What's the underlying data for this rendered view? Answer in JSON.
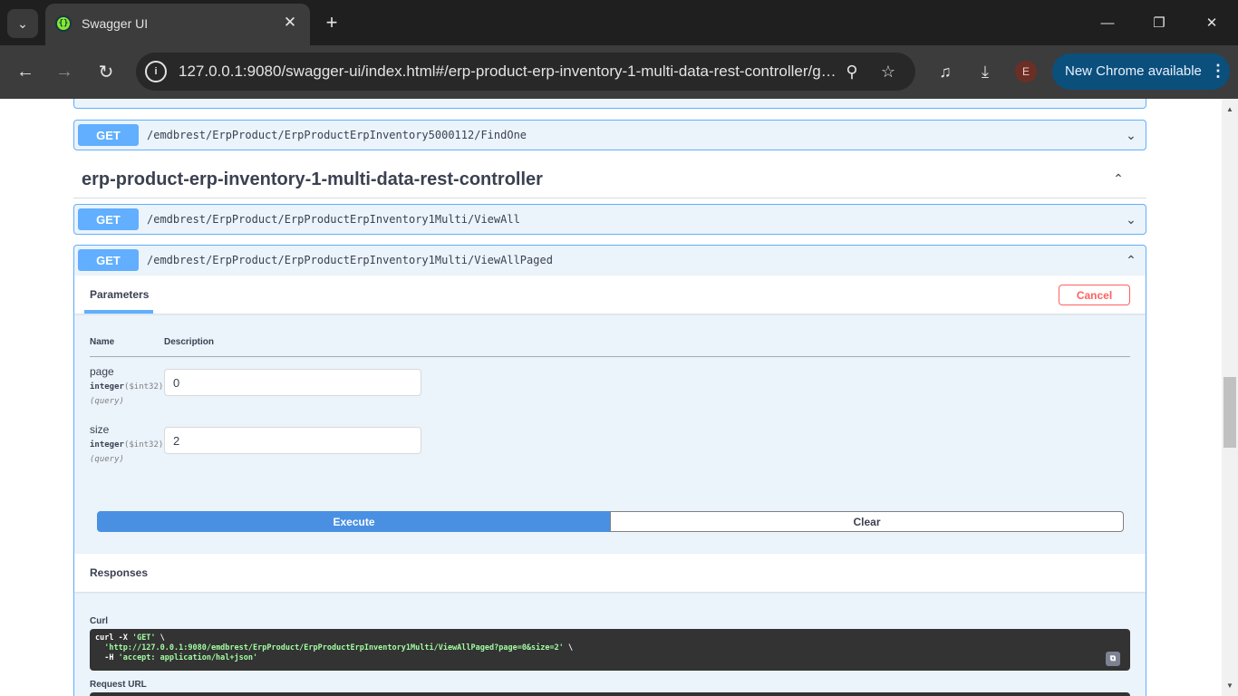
{
  "browser": {
    "tab_title": "Swagger UI",
    "url": "127.0.0.1:9080/swagger-ui/index.html#/erp-product-erp-inventory-1-multi-data-rest-controller/getViewAllPaged",
    "avatar_letter": "E",
    "update_label": "New Chrome available",
    "icons": {
      "tab_menu": "chevron-down-icon",
      "favicon": "swagger-icon",
      "close": "close-icon",
      "new_tab": "plus-icon",
      "back": "back-arrow-icon",
      "forward": "forward-arrow-icon",
      "reload": "reload-icon",
      "site_info": "site-info-icon",
      "zoom": "search-icon",
      "bookmark": "star-icon",
      "media": "media-icon",
      "download": "download-icon",
      "menu": "kebab-icon"
    },
    "colors": {
      "chrome_bg": "#1f1f1f",
      "toolbar_bg": "#3c3c3c",
      "update_chip": "#0b4f7c"
    }
  },
  "page": {
    "prev_op": {
      "method": "GET",
      "path": "/emdbrest/ErpProduct/ErpProductErpInventory5000112/FindOne"
    },
    "tag": {
      "title": "erp-product-erp-inventory-1-multi-data-rest-controller"
    },
    "ops": [
      {
        "method": "GET",
        "path": "/emdbrest/ErpProduct/ErpProductErpInventory1Multi/ViewAll"
      },
      {
        "method": "GET",
        "path": "/emdbrest/ErpProduct/ErpProductErpInventory1Multi/ViewAllPaged"
      }
    ],
    "expanded": {
      "params_tab": "Parameters",
      "cancel_label": "Cancel",
      "col_name": "Name",
      "col_description": "Description",
      "params": [
        {
          "name": "page",
          "type": "integer",
          "format": "($int32)",
          "in": "(query)",
          "value": "0"
        },
        {
          "name": "size",
          "type": "integer",
          "format": "($int32)",
          "in": "(query)",
          "value": "2"
        }
      ],
      "execute_label": "Execute",
      "clear_label": "Clear",
      "responses_label": "Responses",
      "curl_label": "Curl",
      "curl": {
        "l1_cmd": "curl -X ",
        "l1_method": "'GET'",
        "l1_end": " \\",
        "l2_url": "'http://127.0.0.1:9080/emdbrest/ErpProduct/ErpProductErpInventory1Multi/ViewAllPaged?page=0&size=2'",
        "l2_end": " \\",
        "l3_flag": "  -H ",
        "l3_header": "'accept: application/hal+json'"
      },
      "request_url_label": "Request URL"
    },
    "colors": {
      "get_blue": "#61affe",
      "get_bg": "#ebf3fb",
      "execute": "#4990e2",
      "cancel": "#ff6060",
      "code_bg": "#333333"
    }
  }
}
